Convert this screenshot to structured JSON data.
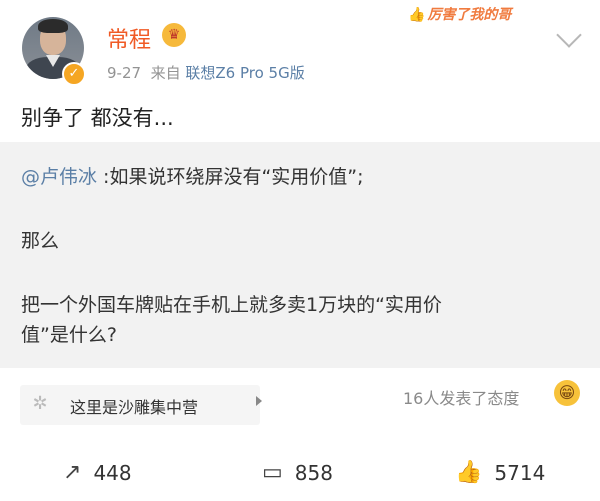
{
  "post": {
    "author": "常程",
    "time": "9-27",
    "source_prefix": "来自",
    "device": "联想Z6 Pro 5G版",
    "sticker_text": "厉害了我的哥",
    "text": "别争了 都没有..."
  },
  "quote": {
    "mention": "@卢伟冰",
    "line1_rest": " :如果说环绕屏没有“实用价值”;",
    "line2": "那么",
    "line3": "把一个外国车牌贴在手机上就多卖1万块的“实用价",
    "line4": "值”是什么?"
  },
  "topic": {
    "label": "这里是沙雕集中营"
  },
  "reactions": {
    "attitude_text": "16人发表了态度"
  },
  "actions": {
    "share_count": "448",
    "comment_count": "858",
    "like_count": "5714"
  },
  "icons": {
    "verified": "verified-badge-icon",
    "vip": "crown-icon",
    "more": "chevron-down-icon",
    "topic": "pinwheel-icon",
    "share": "share-icon",
    "comment": "comment-icon",
    "like": "thumbs-up-icon",
    "reaction": "grin-emoji-icon"
  },
  "colors": {
    "username": "#f05a25",
    "link": "#5b7fa6",
    "quote_bg": "#f2f2f2"
  }
}
